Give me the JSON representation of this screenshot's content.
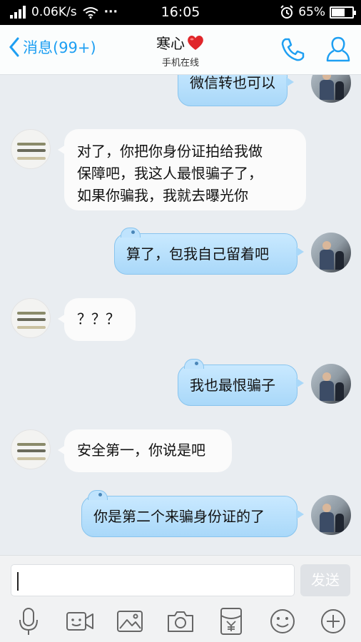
{
  "status_bar": {
    "speed": "0.06K/s",
    "dots": "···",
    "time": "16:05",
    "battery": "65%",
    "battery_level": 0.65
  },
  "header": {
    "back_label": "消息(99+)",
    "contact_name": "寒心",
    "status": "手机在线"
  },
  "messages": [
    {
      "side": "right",
      "text": "微信转也可以"
    },
    {
      "side": "left",
      "lines": [
        "对了，你把你身份证拍给我做",
        "保障吧，我这人最恨骗子了，",
        "如果你骗我，我就去曝光你"
      ]
    },
    {
      "side": "right",
      "text": "算了，包我自己留着吧"
    },
    {
      "side": "left",
      "text": "？？？"
    },
    {
      "side": "right",
      "text": "我也最恨骗子"
    },
    {
      "side": "left",
      "text": "安全第一，你说是吧"
    },
    {
      "side": "right",
      "text": "你是第二个来骗身份证的了"
    }
  ],
  "input": {
    "value": "",
    "send_label": "发送"
  },
  "icons": {
    "back": "chevron-left-icon",
    "heart": "heart-icon",
    "phone": "phone-icon",
    "profile": "profile-icon",
    "voice": "microphone-icon",
    "video": "video-camera-icon",
    "image": "image-icon",
    "camera": "camera-icon",
    "red_packet": "red-packet-icon",
    "emoji": "emoji-icon",
    "more": "plus-icon"
  },
  "colors": {
    "accent": "#1e9ff2",
    "my_bubble": "#b9e0fc",
    "their_bubble": "#fbfbfb",
    "chat_bg": "#e9edf1",
    "heart": "#e0262a"
  }
}
